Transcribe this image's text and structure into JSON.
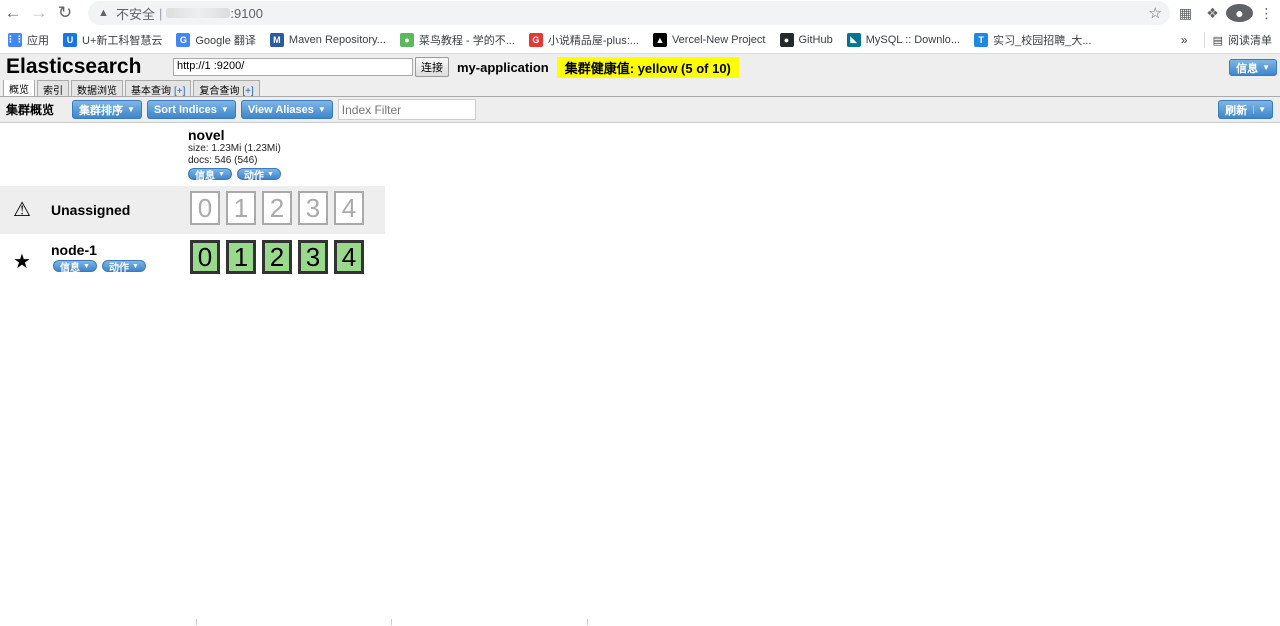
{
  "browser": {
    "insecure_label": "不安全",
    "url_suffix": ":9100",
    "bookmarks": [
      {
        "label": "应用",
        "icon": "apps-grid-icon",
        "color": "#4285f4"
      },
      {
        "label": "U+新工科智慧云",
        "icon": "uplus-icon",
        "color": "#1a73e8"
      },
      {
        "label": "Google 翻译",
        "icon": "google-translate-icon",
        "color": "#4285f4"
      },
      {
        "label": "Maven Repository...",
        "icon": "maven-icon",
        "color": "#2c5aa0"
      },
      {
        "label": "菜鸟教程 - 学的不...",
        "icon": "runoob-icon",
        "color": "#5cb85c"
      },
      {
        "label": "小说精品屋-plus:...",
        "icon": "novel-g-icon",
        "color": "#e53935"
      },
      {
        "label": "Vercel-New Project",
        "icon": "vercel-icon",
        "color": "#000000"
      },
      {
        "label": "GitHub",
        "icon": "github-icon",
        "color": "#24292e"
      },
      {
        "label": "MySQL :: Downlo...",
        "icon": "mysql-icon",
        "color": "#00758f"
      },
      {
        "label": "实习_校园招聘_大...",
        "icon": "job-icon",
        "color": "#1e88e5"
      }
    ],
    "more": "»",
    "reading_list": "阅读清单"
  },
  "es": {
    "title": "Elasticsearch",
    "connect_url": "http://1          :9200/",
    "connect_button": "连接",
    "cluster_name": "my-application",
    "health": "集群健康值: yellow (5 of 10)",
    "info_button": "信息",
    "tabs": [
      {
        "label": "概览",
        "plus": ""
      },
      {
        "label": "索引",
        "plus": ""
      },
      {
        "label": "数据浏览",
        "plus": ""
      },
      {
        "label": "基本查询",
        "plus": "[+]"
      },
      {
        "label": "复合查询",
        "plus": "[+]"
      }
    ],
    "toolbar": {
      "label": "集群概览",
      "sort_cluster": "集群排序",
      "sort_indices": "Sort Indices",
      "view_aliases": "View Aliases",
      "filter_placeholder": "Index Filter",
      "refresh": "刷新"
    },
    "index": {
      "name": "novel",
      "size": "size: 1.23Mi (1.23Mi)",
      "docs": "docs: 546 (546)",
      "info": "信息",
      "action": "动作"
    },
    "unassigned": {
      "label": "Unassigned",
      "shards": [
        "0",
        "1",
        "2",
        "3",
        "4"
      ]
    },
    "node": {
      "label": "node-1",
      "info": "信息",
      "action": "动作",
      "shards": [
        "0",
        "1",
        "2",
        "3",
        "4"
      ]
    }
  }
}
